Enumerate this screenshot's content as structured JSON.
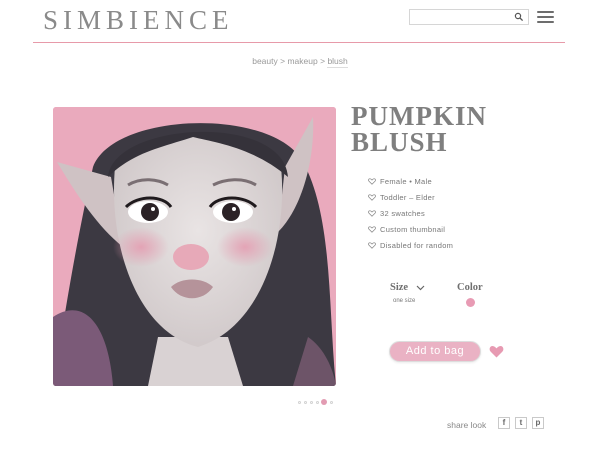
{
  "header": {
    "logo": "SIMBIENCE",
    "search": {
      "value": "",
      "placeholder": ""
    },
    "icons": [
      "search-icon",
      "menu-icon"
    ]
  },
  "breadcrumb": {
    "items": [
      "beauty",
      "makeup",
      "blush"
    ],
    "separator": ">"
  },
  "gallery": {
    "image": "pink-haired elf sim portrait with pink blush on pink background",
    "current_slide": 4,
    "total_slides": 6
  },
  "product": {
    "title_line1": "PUMPKIN",
    "title_line2": "BLUSH",
    "features": [
      "Female  •  Male",
      "Toddler  –  Elder",
      "32  swatches",
      "Custom  thumbnail",
      "Disabled  for  random"
    ],
    "feature_icon": "heart-outline-icon",
    "size_label": "Size",
    "size_value": "one  size",
    "color_label": "Color",
    "selected_color": "#e89bb4",
    "add_button": "Add to bag",
    "favorite_icon": "heart-icon"
  },
  "share": {
    "label": "share look",
    "buttons": [
      "f",
      "t",
      "p"
    ]
  },
  "colors": {
    "accent": "#e79aa9",
    "button": "#eab2c4",
    "text": "#7f7f7f"
  }
}
